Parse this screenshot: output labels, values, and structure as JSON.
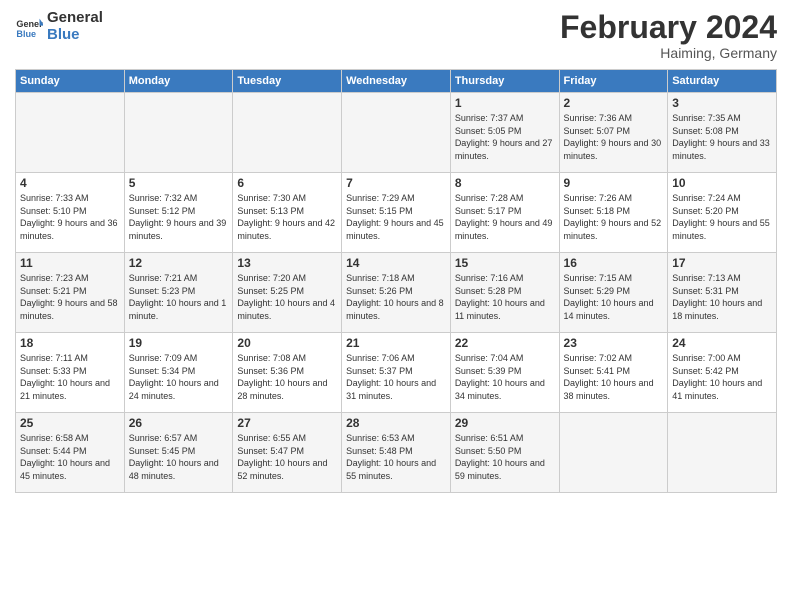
{
  "header": {
    "logo_general": "General",
    "logo_blue": "Blue",
    "title": "February 2024",
    "subtitle": "Haiming, Germany"
  },
  "days_of_week": [
    "Sunday",
    "Monday",
    "Tuesday",
    "Wednesday",
    "Thursday",
    "Friday",
    "Saturday"
  ],
  "weeks": [
    [
      {
        "day": "",
        "info": ""
      },
      {
        "day": "",
        "info": ""
      },
      {
        "day": "",
        "info": ""
      },
      {
        "day": "",
        "info": ""
      },
      {
        "day": "1",
        "info": "Sunrise: 7:37 AM\nSunset: 5:05 PM\nDaylight: 9 hours and 27 minutes."
      },
      {
        "day": "2",
        "info": "Sunrise: 7:36 AM\nSunset: 5:07 PM\nDaylight: 9 hours and 30 minutes."
      },
      {
        "day": "3",
        "info": "Sunrise: 7:35 AM\nSunset: 5:08 PM\nDaylight: 9 hours and 33 minutes."
      }
    ],
    [
      {
        "day": "4",
        "info": "Sunrise: 7:33 AM\nSunset: 5:10 PM\nDaylight: 9 hours and 36 minutes."
      },
      {
        "day": "5",
        "info": "Sunrise: 7:32 AM\nSunset: 5:12 PM\nDaylight: 9 hours and 39 minutes."
      },
      {
        "day": "6",
        "info": "Sunrise: 7:30 AM\nSunset: 5:13 PM\nDaylight: 9 hours and 42 minutes."
      },
      {
        "day": "7",
        "info": "Sunrise: 7:29 AM\nSunset: 5:15 PM\nDaylight: 9 hours and 45 minutes."
      },
      {
        "day": "8",
        "info": "Sunrise: 7:28 AM\nSunset: 5:17 PM\nDaylight: 9 hours and 49 minutes."
      },
      {
        "day": "9",
        "info": "Sunrise: 7:26 AM\nSunset: 5:18 PM\nDaylight: 9 hours and 52 minutes."
      },
      {
        "day": "10",
        "info": "Sunrise: 7:24 AM\nSunset: 5:20 PM\nDaylight: 9 hours and 55 minutes."
      }
    ],
    [
      {
        "day": "11",
        "info": "Sunrise: 7:23 AM\nSunset: 5:21 PM\nDaylight: 9 hours and 58 minutes."
      },
      {
        "day": "12",
        "info": "Sunrise: 7:21 AM\nSunset: 5:23 PM\nDaylight: 10 hours and 1 minute."
      },
      {
        "day": "13",
        "info": "Sunrise: 7:20 AM\nSunset: 5:25 PM\nDaylight: 10 hours and 4 minutes."
      },
      {
        "day": "14",
        "info": "Sunrise: 7:18 AM\nSunset: 5:26 PM\nDaylight: 10 hours and 8 minutes."
      },
      {
        "day": "15",
        "info": "Sunrise: 7:16 AM\nSunset: 5:28 PM\nDaylight: 10 hours and 11 minutes."
      },
      {
        "day": "16",
        "info": "Sunrise: 7:15 AM\nSunset: 5:29 PM\nDaylight: 10 hours and 14 minutes."
      },
      {
        "day": "17",
        "info": "Sunrise: 7:13 AM\nSunset: 5:31 PM\nDaylight: 10 hours and 18 minutes."
      }
    ],
    [
      {
        "day": "18",
        "info": "Sunrise: 7:11 AM\nSunset: 5:33 PM\nDaylight: 10 hours and 21 minutes."
      },
      {
        "day": "19",
        "info": "Sunrise: 7:09 AM\nSunset: 5:34 PM\nDaylight: 10 hours and 24 minutes."
      },
      {
        "day": "20",
        "info": "Sunrise: 7:08 AM\nSunset: 5:36 PM\nDaylight: 10 hours and 28 minutes."
      },
      {
        "day": "21",
        "info": "Sunrise: 7:06 AM\nSunset: 5:37 PM\nDaylight: 10 hours and 31 minutes."
      },
      {
        "day": "22",
        "info": "Sunrise: 7:04 AM\nSunset: 5:39 PM\nDaylight: 10 hours and 34 minutes."
      },
      {
        "day": "23",
        "info": "Sunrise: 7:02 AM\nSunset: 5:41 PM\nDaylight: 10 hours and 38 minutes."
      },
      {
        "day": "24",
        "info": "Sunrise: 7:00 AM\nSunset: 5:42 PM\nDaylight: 10 hours and 41 minutes."
      }
    ],
    [
      {
        "day": "25",
        "info": "Sunrise: 6:58 AM\nSunset: 5:44 PM\nDaylight: 10 hours and 45 minutes."
      },
      {
        "day": "26",
        "info": "Sunrise: 6:57 AM\nSunset: 5:45 PM\nDaylight: 10 hours and 48 minutes."
      },
      {
        "day": "27",
        "info": "Sunrise: 6:55 AM\nSunset: 5:47 PM\nDaylight: 10 hours and 52 minutes."
      },
      {
        "day": "28",
        "info": "Sunrise: 6:53 AM\nSunset: 5:48 PM\nDaylight: 10 hours and 55 minutes."
      },
      {
        "day": "29",
        "info": "Sunrise: 6:51 AM\nSunset: 5:50 PM\nDaylight: 10 hours and 59 minutes."
      },
      {
        "day": "",
        "info": ""
      },
      {
        "day": "",
        "info": ""
      }
    ]
  ]
}
